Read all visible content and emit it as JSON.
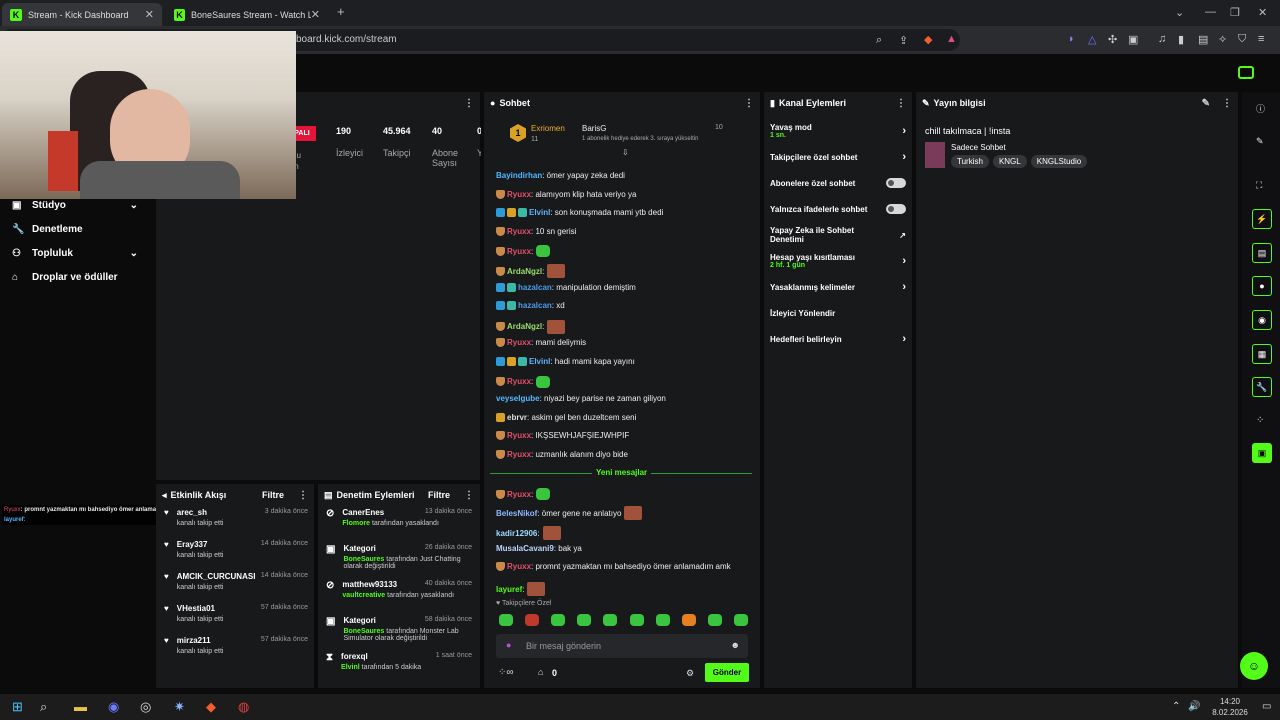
{
  "browser": {
    "tabs": [
      {
        "title": "Stream - Kick Dashboard",
        "active": true
      },
      {
        "title": "BoneSaures Stream - Watch Live on K",
        "active": false
      }
    ],
    "url": "board.kick.com/stream"
  },
  "sidebar": {
    "items": [
      {
        "label": "Stüdyo",
        "icon": "studio-icon",
        "chevron": true
      },
      {
        "label": "Denetleme",
        "icon": "wrench-icon",
        "chevron": false
      },
      {
        "label": "Topluluk",
        "icon": "community-icon",
        "chevron": true
      },
      {
        "label": "Droplar ve ödüller",
        "icon": "gift-icon",
        "chevron": false
      }
    ],
    "overlay_chat": [
      {
        "user": "Ryuxx",
        "text": ": promnt yazmaktan mı bahsediyo ömer anlamadım amk"
      },
      {
        "user": "layuref",
        "text": ":"
      }
    ]
  },
  "stats": {
    "offline_badge": "PALI",
    "partial": [
      "du",
      "ın"
    ],
    "items": [
      {
        "value": "190",
        "label": "İzleyici"
      },
      {
        "value": "45.964",
        "label": "Takipçi"
      },
      {
        "value": "40",
        "label": "Abone Sayısı"
      },
      {
        "value": "0",
        "label": "Y"
      }
    ]
  },
  "chat": {
    "title": "Sohbet",
    "pinned": {
      "rank": "1",
      "user1": "Exriomen",
      "count1": "11",
      "user2": "BarisG",
      "count2": "10",
      "note": "1 abonelik hediye ederek 3. sıraya yükseltin"
    },
    "messages": [
      {
        "user": "Bayindirhan",
        "color": "#53b8ff",
        "badges": [],
        "text": ": ömer yapay zeka dedi",
        "emote": null
      },
      {
        "user": "Ryuxx",
        "color": "#e54e6b",
        "badges": [
          "shield"
        ],
        "text": ": alamıyom klip hata veriyo ya",
        "emote": null
      },
      {
        "user": "Elvinl",
        "color": "#5fb3ff",
        "badges": [
          "blue",
          "crown",
          "green"
        ],
        "text": ": son konuşmada mami ytb dedi",
        "emote": null
      },
      {
        "user": "Ryuxx",
        "color": "#e54e6b",
        "badges": [
          "shield"
        ],
        "text": ": 10 sn gerisi",
        "emote": null
      },
      {
        "user": "Ryuxx",
        "color": "#e54e6b",
        "badges": [
          "shield"
        ],
        "text": ":",
        "emote": "green"
      },
      {
        "user": "ArdaNgzl",
        "color": "#9bdc6a",
        "badges": [
          "shield"
        ],
        "text": ":",
        "emote": "face"
      },
      {
        "user": "hazalcan",
        "color": "#4b9ce8",
        "badges": [
          "blue",
          "green"
        ],
        "text": ": manipulation demiştim",
        "emote": null
      },
      {
        "user": "hazalcan",
        "color": "#4b9ce8",
        "badges": [
          "blue",
          "green"
        ],
        "text": ": xd",
        "emote": null
      },
      {
        "user": "ArdaNgzl",
        "color": "#9bdc6a",
        "badges": [
          "shield"
        ],
        "text": ":",
        "emote": "face"
      },
      {
        "user": "Ryuxx",
        "color": "#e54e6b",
        "badges": [
          "shield"
        ],
        "text": ": mami deliymis",
        "emote": null
      },
      {
        "user": "Elvinl",
        "color": "#5fb3ff",
        "badges": [
          "blue",
          "crown",
          "green"
        ],
        "text": ": hadi mami kapa yayını",
        "emote": null
      },
      {
        "user": "Ryuxx",
        "color": "#e54e6b",
        "badges": [
          "shield"
        ],
        "text": ":",
        "emote": "green"
      },
      {
        "user": "veyselgube",
        "color": "#53b8ff",
        "badges": [],
        "text": ": niyazi bey parise ne zaman giliyon",
        "emote": null
      },
      {
        "user": "ebrvr",
        "color": "#dddddd",
        "badges": [
          "crown"
        ],
        "text": ": askim gel ben duzeltcem seni",
        "emote": null
      },
      {
        "user": "Ryuxx",
        "color": "#e54e6b",
        "badges": [
          "shield"
        ],
        "text": ": IKŞSEWHJAFŞIEJWHPIF",
        "emote": null
      },
      {
        "user": "Ryuxx",
        "color": "#e54e6b",
        "badges": [
          "shield"
        ],
        "text": ": uzmanlık alanım diyo bide",
        "emote": null
      }
    ],
    "divider": "Yeni mesajlar",
    "new_messages": [
      {
        "user": "Ryuxx",
        "color": "#e54e6b",
        "badges": [
          "shield"
        ],
        "text": ":",
        "emote": "green"
      },
      {
        "user": "BelesNikof",
        "color": "#8fb8ff",
        "badges": [],
        "text": ": ömer gene ne anlatıyo",
        "emote": "face"
      },
      {
        "user": "kadir12906",
        "color": "#a0d8ff",
        "badges": [],
        "text": ":",
        "emote": "face"
      },
      {
        "user": "MusalaCavani9",
        "color": "#bdd5ff",
        "badges": [],
        "text": ": bak ya",
        "emote": null
      },
      {
        "user": "Ryuxx",
        "color": "#e54e6b",
        "badges": [
          "shield"
        ],
        "text": ": promnt yazmaktan mı bahsediyo ömer anlamadım amk",
        "emote": null
      },
      {
        "user": "layuref",
        "color": "#53fc18",
        "badges": [],
        "text": ":",
        "emote": "face"
      }
    ],
    "followers_only": "Takipçilere Özel",
    "placeholder": "Bir mesaj gönderin",
    "points": "0",
    "send": "Gönder"
  },
  "channel_actions": {
    "title": "Kanal Eylemleri",
    "items": [
      {
        "label": "Yavaş mod",
        "sub": "1 sn.",
        "control": "arrow"
      },
      {
        "label": "Takipçilere özel sohbet",
        "sub": "",
        "control": "arrow"
      },
      {
        "label": "Abonelere özel sohbet",
        "sub": "",
        "control": "toggle"
      },
      {
        "label": "Yalnızca ifadelerle sohbet",
        "sub": "",
        "control": "toggle"
      },
      {
        "label": "Yapay Zeka ile Sohbet Denetimi",
        "sub": "",
        "control": "chart"
      },
      {
        "label": "Hesap yaşı kısıtlaması",
        "sub": "2 hf. 1 gün",
        "control": "arrow"
      },
      {
        "label": "Yasaklanmış kelimeler",
        "sub": "",
        "control": "arrow"
      },
      {
        "label": "İzleyici Yönlendir",
        "sub": "",
        "control": "none"
      },
      {
        "label": "Hedefleri belirleyin",
        "sub": "",
        "control": "arrow"
      }
    ]
  },
  "stream_info": {
    "title": "Yayın bilgisi",
    "stream_title": "chill takılmaca | !insta",
    "category": "Sadece Sohbet",
    "tags": [
      "Turkish",
      "KNGL",
      "KNGLStudio"
    ]
  },
  "activity": {
    "title": "Etkinlik Akışı",
    "filter": "Filtre",
    "items": [
      {
        "user": "arec_sh",
        "action": "kanalı takip etti",
        "time": "3 dakika önce"
      },
      {
        "user": "Eray337",
        "action": "kanalı takip etti",
        "time": "14 dakika önce"
      },
      {
        "user": "AMCIK_CURCUNASI",
        "action": "kanalı takip etti",
        "time": "14 dakika önce"
      },
      {
        "user": "VHestia01",
        "action": "kanalı takip etti",
        "time": "57 dakika önce"
      },
      {
        "user": "mirza211",
        "action": "kanalı takip etti",
        "time": "57 dakika önce"
      }
    ]
  },
  "mod_actions": {
    "title": "Denetim Eylemleri",
    "filter": "Filtre",
    "items": [
      {
        "title": "CanerEnes",
        "time": "13 dakika önce",
        "hl": "Flomore",
        "rest": " tarafından yasaklandı",
        "icon": "ban-icon"
      },
      {
        "title": "Kategori",
        "time": "26 dakika önce",
        "hl": "BoneSaures",
        "rest": " tarafından Just Chatting olarak değiştirildi",
        "icon": "category-icon"
      },
      {
        "title": "matthew93133",
        "time": "40 dakika önce",
        "hl": "vaultcreative",
        "rest": " tarafından yasaklandı",
        "icon": "ban-icon"
      },
      {
        "title": "Kategori",
        "time": "58 dakika önce",
        "hl": "BoneSaures",
        "rest": " tarafından Monster Lab Simulator olarak değiştirildi",
        "icon": "category-icon"
      },
      {
        "title": "forexql",
        "time": "1 saat önce",
        "hl": "Elvinl",
        "rest": " tarafından 5 dakika",
        "icon": "timeout-icon"
      }
    ]
  },
  "taskbar": {
    "time": "14:20",
    "date": "8.02.2026"
  },
  "colors": {
    "accent": "#53fc18",
    "panel": "#18191b"
  }
}
